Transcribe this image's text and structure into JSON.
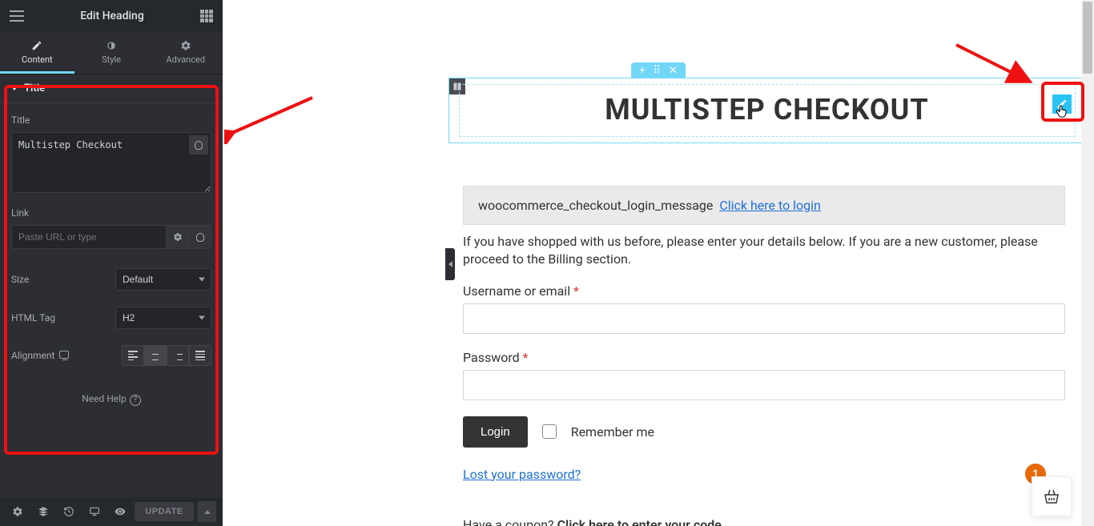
{
  "sidebar": {
    "header_title": "Edit Heading",
    "tabs": {
      "content": "Content",
      "style": "Style",
      "advanced": "Advanced"
    },
    "section_title": "Title",
    "title_label": "Title",
    "title_value": "Multistep Checkout",
    "link_label": "Link",
    "link_placeholder": "Paste URL or type",
    "size_label": "Size",
    "size_value": "Default",
    "htmltag_label": "HTML Tag",
    "htmltag_value": "H2",
    "alignment_label": "Alignment",
    "help_text": "Need Help",
    "update_label": "UPDATE"
  },
  "canvas": {
    "heading": "MULTISTEP CHECKOUT",
    "login_msg_key": "woocommerce_checkout_login_message",
    "login_link": "Click here to login",
    "shop_message": "If you have shopped with us before, please enter your details below. If you are a new customer, please proceed to the Billing section.",
    "username_label": "Username or email ",
    "password_label": "Password ",
    "login_btn": "Login",
    "remember_label": "Remember me",
    "lost_password": "Lost your password?",
    "coupon_prefix": "Have a coupon? ",
    "coupon_link": "Click here to enter your code",
    "cart_count": "1"
  }
}
